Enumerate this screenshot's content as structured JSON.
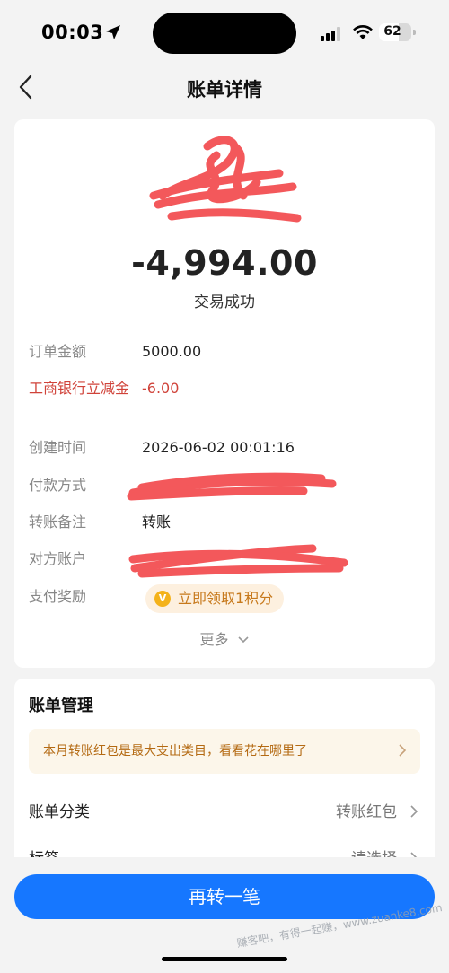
{
  "status_bar": {
    "time": "00:03",
    "battery": "62"
  },
  "nav": {
    "title": "账单详情"
  },
  "summary": {
    "amount": "-4,994.00",
    "status": "交易成功"
  },
  "details": [
    {
      "label": "订单金额",
      "value": "5000.00"
    },
    {
      "label": "工商银行立减金",
      "value": "-6.00"
    },
    {
      "label": "创建时间",
      "value": "2026-06-02 00:01:16"
    },
    {
      "label": "付款方式",
      "value": ""
    },
    {
      "label": "转账备注",
      "value": "转账"
    },
    {
      "label": "对方账户",
      "value": ""
    },
    {
      "label": "支付奖励",
      "value": "立即领取1积分"
    }
  ],
  "more_label": "更多",
  "management": {
    "title": "账单管理",
    "tip": "本月转账红包是最大支出类目，看看花在哪里了",
    "rows": [
      {
        "label": "账单分类",
        "value": "转账红包"
      },
      {
        "label": "标签",
        "value": "请选择"
      }
    ]
  },
  "primary_button": "再转一笔",
  "watermark": "赚客吧，有得一起赚，www.zuanke8.com",
  "colors": {
    "accent": "#1677ff",
    "discount": "#d0433a",
    "tip_text": "#b46a13",
    "redaction": "#f2474a"
  }
}
